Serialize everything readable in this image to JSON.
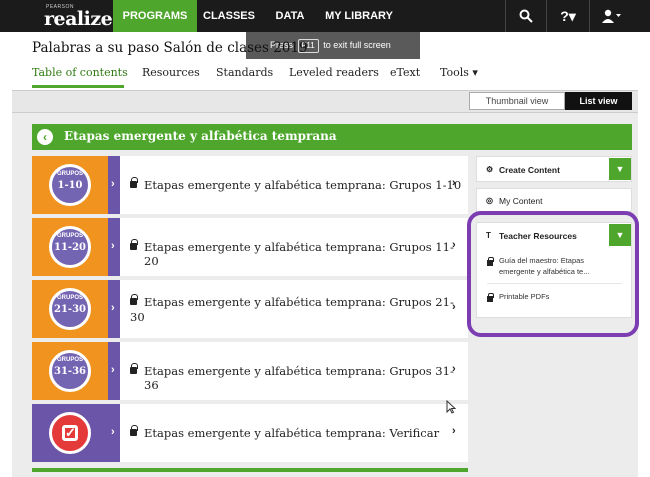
{
  "topnav": {
    "logo_small": "PEARSON",
    "logo": "realize.",
    "items": [
      "PROGRAMS",
      "CLASSES",
      "DATA",
      "MY LIBRARY"
    ],
    "search_icon": "search-icon",
    "help_icon": "?▾",
    "user_icon": "user-icon"
  },
  "toast": {
    "pre": "Press",
    "key": "F11",
    "post": "to exit full screen"
  },
  "header": {
    "title": "Palabras a su paso Salón de clases 2019",
    "tabs": [
      "Table of contents",
      "Resources",
      "Standards",
      "Leveled readers",
      "eText",
      "Tools ▾"
    ]
  },
  "view_toggle": {
    "thumbnail": "Thumbnail view",
    "list": "List view",
    "selected": "List view"
  },
  "section": {
    "title": "Etapas emergente y alfabética temprana"
  },
  "rows": [
    {
      "badge_top": "GRUPOS",
      "badge": "1-10",
      "label": "Etapas emergente y alfabética temprana: Grupos 1-10"
    },
    {
      "badge_top": "GRUPOS",
      "badge": "11-20",
      "label": "Etapas emergente y alfabética temprana: Grupos 11-20"
    },
    {
      "badge_top": "GRUPOS",
      "badge": "21-30",
      "label_line1": "Etapas emergente y alfabética temprana: Grupos 21-",
      "label_line2": "30"
    },
    {
      "badge_top": "GRUPOS",
      "badge": "31-36",
      "label": "Etapas emergente y alfabética temprana: Grupos 31-36"
    },
    {
      "badge": "check",
      "label": "Etapas emergente y alfabética temprana: Verificar"
    }
  ],
  "panel": {
    "create": "Create Content",
    "my_content": "My Content",
    "teacher": "Teacher Resources",
    "resources": [
      {
        "line1": "Guía del maestro: Etapas",
        "line2": "emergente y alfabética te..."
      },
      {
        "line1": "Printable PDFs"
      }
    ]
  },
  "colors": {
    "accent": "#4ea72c",
    "nav": "#1b1b1b",
    "highlight": "#7b3db1",
    "badge": "#7465b3",
    "thumb": "#f0941f"
  }
}
